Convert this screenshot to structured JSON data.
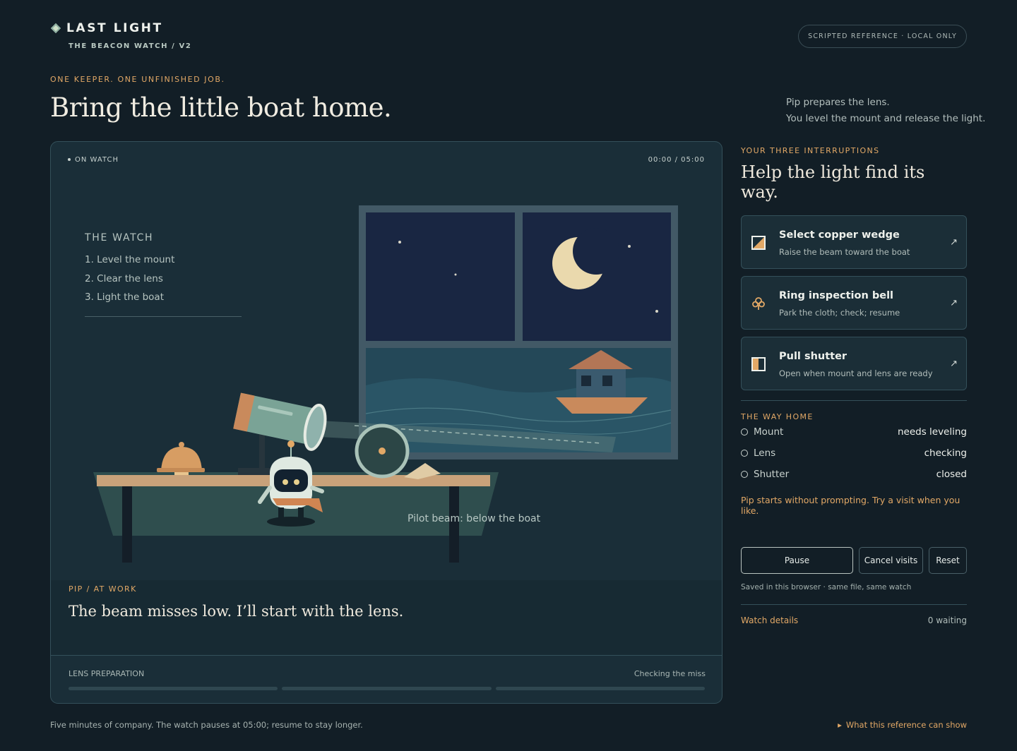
{
  "brand": {
    "title": "LAST LIGHT",
    "subtitle": "THE BEACON WATCH / V2"
  },
  "badge": "SCRIPTED REFERENCE · LOCAL ONLY",
  "hero": {
    "eyebrow": "ONE KEEPER. ONE UNFINISHED JOB.",
    "headline": "Bring the little boat home.",
    "intro_line1": "Pip prepares the lens.",
    "intro_line2": "You level the mount and release the light."
  },
  "stage": {
    "status": "ON WATCH",
    "timer": "00:00 / 05:00",
    "watch": {
      "title": "THE WATCH",
      "steps": [
        "1. Level the mount",
        "2. Clear the lens",
        "3. Light the boat"
      ]
    },
    "beam_label": "Pilot beam: below the boat",
    "caption": {
      "speaker": "PIP / AT WORK",
      "line": "The beam misses low. I’ll start with the lens."
    },
    "progress": {
      "label": "LENS PREPARATION",
      "status": "Checking the miss",
      "segments": 3
    }
  },
  "panel": {
    "eyebrow": "YOUR THREE INTERRUPTIONS",
    "title": "Help the light find its way.",
    "tools": [
      {
        "name": "Select copper wedge",
        "desc": "Raise the beam toward the boat",
        "icon": "wedge-icon"
      },
      {
        "name": "Ring inspection bell",
        "desc": "Park the cloth; check; resume",
        "icon": "bell-icon"
      },
      {
        "name": "Pull shutter",
        "desc": "Open when mount and lens are ready",
        "icon": "shutter-icon"
      }
    ],
    "arrow": "↗",
    "way": {
      "title": "THE WAY HOME",
      "rows": [
        {
          "name": "Mount",
          "value": "needs leveling"
        },
        {
          "name": "Lens",
          "value": "checking"
        },
        {
          "name": "Shutter",
          "value": "closed"
        }
      ],
      "hint": "Pip starts without prompting. Try a visit when you like."
    },
    "controls": {
      "pause": "Pause",
      "cancel": "Cancel visits",
      "reset": "Reset"
    },
    "saved": "Saved in this browser · same file, same watch",
    "details": "Watch details",
    "waiting": "0 waiting"
  },
  "footer": {
    "note": "Five minutes of company. The watch pauses at 05:00; resume to stay longer.",
    "link": "What this reference can show"
  },
  "colors": {
    "accent": "#e2a866",
    "background": "#121e26",
    "card": "#1a2e38",
    "copper": "#c98a5c",
    "sea": "#24495a"
  }
}
